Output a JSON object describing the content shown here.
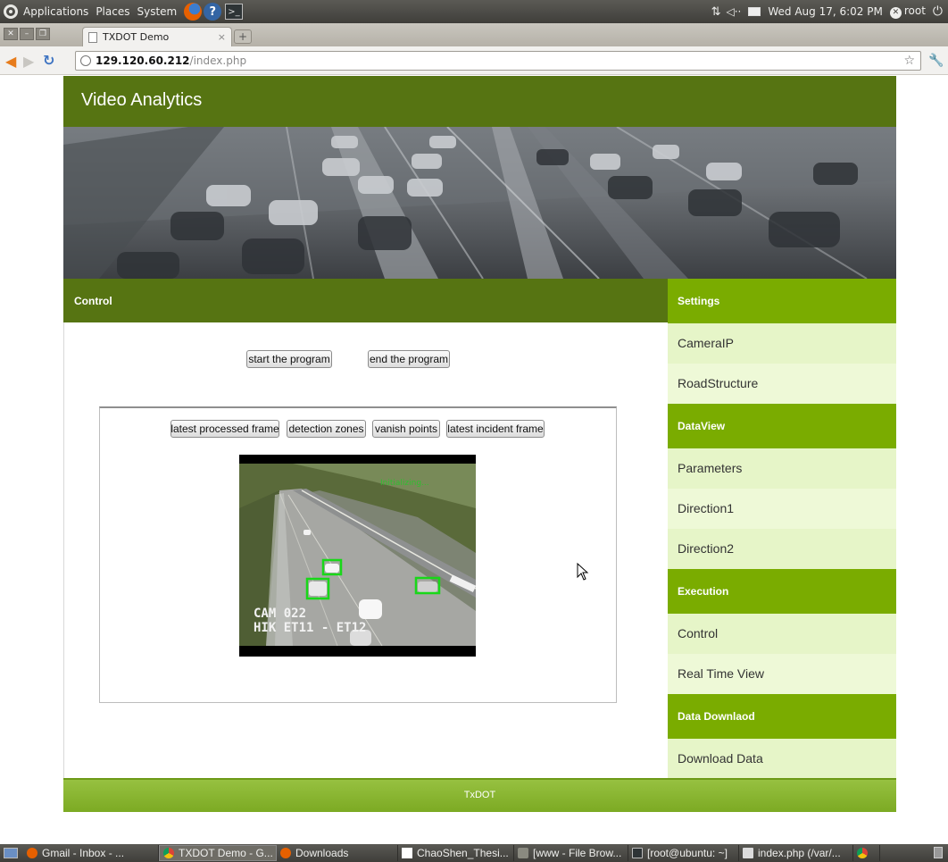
{
  "panel": {
    "menus": [
      "Applications",
      "Places",
      "System"
    ],
    "datetime": "Wed Aug 17,  6:02 PM",
    "user": "root"
  },
  "browser": {
    "tab_title": "TXDOT Demo",
    "url_host": "129.120.60.212",
    "url_path": "/index.php"
  },
  "site": {
    "title": "Video Analytics",
    "control_heading": "Control",
    "buttons": {
      "start": "start the program",
      "end": "end the program"
    },
    "view_buttons": [
      "latest processed frame",
      "detection zones",
      "vanish points",
      "latest incident frame"
    ],
    "video": {
      "status": "Initializing...",
      "cam_line1": "CAM 022",
      "cam_line2": "HIK ET11 - ET12"
    },
    "sidebar": [
      {
        "type": "heading",
        "label": "Settings"
      },
      {
        "type": "item",
        "label": "CameraIP"
      },
      {
        "type": "item",
        "label": "RoadStructure"
      },
      {
        "type": "heading",
        "label": "DataView"
      },
      {
        "type": "item",
        "label": "Parameters"
      },
      {
        "type": "item",
        "label": "Direction1"
      },
      {
        "type": "item",
        "label": "Direction2"
      },
      {
        "type": "heading",
        "label": "Execution"
      },
      {
        "type": "item",
        "label": "Control"
      },
      {
        "type": "item",
        "label": "Real Time View"
      },
      {
        "type": "heading",
        "label": "Data Downlaod"
      },
      {
        "type": "item",
        "label": "Download Data"
      }
    ],
    "footer": "TxDOT"
  },
  "taskbar": {
    "items": [
      {
        "label": "Gmail - Inbox - ...",
        "icon": "firefox-icon"
      },
      {
        "label": "TXDOT Demo - G...",
        "icon": "chrome-icon",
        "active": true
      },
      {
        "label": "Downloads",
        "icon": "firefox-icon"
      },
      {
        "label": "ChaoShen_Thesi...",
        "icon": "document-icon"
      },
      {
        "label": "[www - File Brow...",
        "icon": "folder-icon"
      },
      {
        "label": "[root@ubuntu: ~]",
        "icon": "terminal-icon"
      },
      {
        "label": "index.php (/var/...",
        "icon": "text-editor-icon"
      },
      {
        "label": "",
        "icon": "chrome-icon"
      }
    ]
  },
  "colors": {
    "header_green": "#567412",
    "sidebar_heading": "#7aac00",
    "sidebar_item": "#e6f5c8",
    "footer_green": "#8bb832"
  }
}
